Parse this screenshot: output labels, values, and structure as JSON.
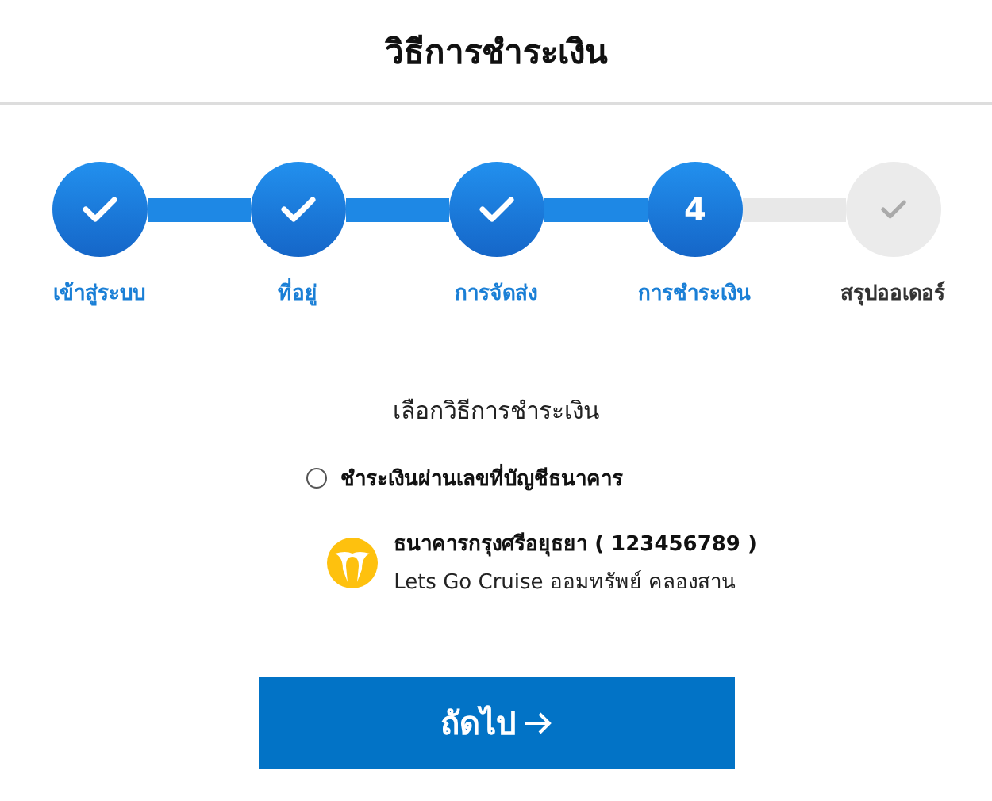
{
  "title": "วิธีการชำระเงิน",
  "steps": [
    {
      "label": "เข้าสู่ระบบ",
      "completed": true,
      "active": false
    },
    {
      "label": "ที่อยู่",
      "completed": true,
      "active": false
    },
    {
      "label": "การจัดส่ง",
      "completed": true,
      "active": false
    },
    {
      "label": "การชำระเงิน",
      "completed": false,
      "active": true,
      "number": "4"
    },
    {
      "label": "สรุปออเดอร์",
      "completed": false,
      "active": false
    }
  ],
  "payment": {
    "heading": "เลือกวิธีการชำระเงิน",
    "options": [
      {
        "label": "ชำระเงินผ่านเลขที่บัญชีธนาคาร",
        "selected": false
      }
    ],
    "bank": {
      "name": "ธนาคารกรุงศรีอยุธยา ( 123456789 )",
      "account": "Lets Go Cruise ออมทรัพย์ คลองสาน"
    }
  },
  "next_button": "ถัดไป"
}
